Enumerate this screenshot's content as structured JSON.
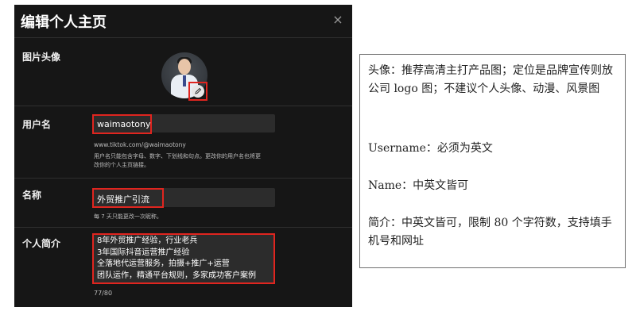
{
  "dialog": {
    "title": "编辑个人主页",
    "close_glyph": "×",
    "avatar": {
      "label": "图片头像",
      "edit_icon": "pencil-icon"
    },
    "username": {
      "label": "用户名",
      "value": "waimaotony",
      "url": "www.tiktok.com/@waimaotony",
      "hint_line1": "用户名只能包含字母、数字、下划线和句点。更改你的用户名也将更",
      "hint_line2": "改你的个人主页链接。"
    },
    "name": {
      "label": "名称",
      "value": "外贸推广引流",
      "hint": "每 7 天只能更改一次昵称。"
    },
    "bio": {
      "label": "个人简介",
      "lines": [
        "8年外贸推广经验，行业老兵",
        "3年国际抖音运营推广经验",
        "全落地代运营服务，拍摄+推广+运营",
        "团队运作，精通平台规则，多家成功客户案例"
      ],
      "counter": "77/80"
    }
  },
  "notes": {
    "avatar_note": "头像：推荐高清主打产品图；定位是品牌宣传则放公司 logo 图；不建议个人头像、动漫、风景图",
    "username_note": "Username：必须为英文",
    "name_note": "Name：中英文皆可",
    "bio_note": "简介：中英文皆可，限制 80 个字符数，支持填手机号和网址"
  },
  "colors": {
    "dialog_bg": "#161616",
    "field_bg": "#2c2c2c",
    "highlight": "#e0251f"
  }
}
